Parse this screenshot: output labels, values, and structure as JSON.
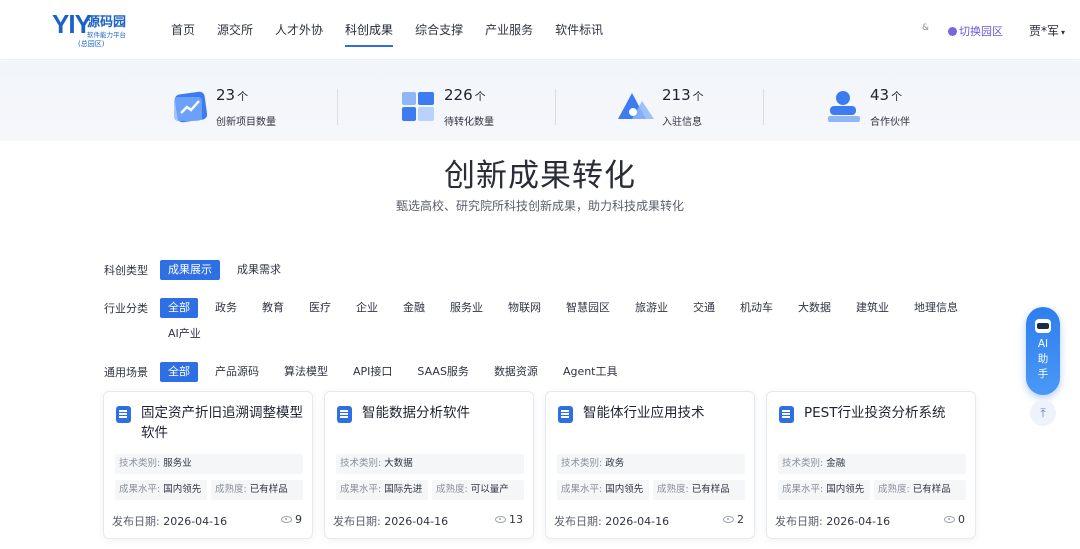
{
  "logo": {
    "mark": "YIY",
    "name": "源码园",
    "subtitle": "软件能力平台",
    "park": "(总园区)"
  },
  "nav": {
    "items": [
      {
        "label": "首页"
      },
      {
        "label": "源交所"
      },
      {
        "label": "人才外协"
      },
      {
        "label": "科创成果",
        "active": true
      },
      {
        "label": "综合支撑"
      },
      {
        "label": "产业服务"
      },
      {
        "label": "软件标讯"
      }
    ]
  },
  "header_right": {
    "lang": "&",
    "switch_label": "切换园区",
    "user_name": "贾*军",
    "caret": "▾"
  },
  "stats": [
    {
      "value": "23",
      "unit": "个",
      "label": "创新项目数量",
      "icon": "chart-growth-icon"
    },
    {
      "value": "226",
      "unit": "个",
      "label": "待转化数量",
      "icon": "blocks-icon"
    },
    {
      "value": "213",
      "unit": "个",
      "label": "入驻信息",
      "icon": "triangle-shapes-icon"
    },
    {
      "value": "43",
      "unit": "个",
      "label": "合作伙伴",
      "icon": "partner-person-icon"
    }
  ],
  "hero": {
    "title": "创新成果转化",
    "subtitle": "甄选高校、研究院所科技创新成果，助力科技成果转化"
  },
  "filters": {
    "type": {
      "label": "科创类型",
      "options": [
        "成果展示",
        "成果需求"
      ],
      "selected": 0
    },
    "industry": {
      "label": "行业分类",
      "options": [
        "全部",
        "政务",
        "教育",
        "医疗",
        "企业",
        "金融",
        "服务业",
        "物联网",
        "智慧园区",
        "旅游业",
        "交通",
        "机动车",
        "大数据",
        "建筑业",
        "地理信息",
        "AI产业"
      ],
      "selected": 0
    },
    "scene": {
      "label": "通用场景",
      "options": [
        "全部",
        "产品源码",
        "算法模型",
        "API接口",
        "SAAS服务",
        "数据资源",
        "Agent工具"
      ],
      "selected": 0
    }
  },
  "cards": [
    {
      "title": "固定资产折旧追溯调整模型软件",
      "tech_key": "技术类别:",
      "tech": "服务业",
      "level_key": "成果水平:",
      "level": "国内领先",
      "maturity_key": "成熟度:",
      "maturity": "已有样品",
      "date_key": "发布日期:",
      "date": "2026-04-16",
      "views": "9"
    },
    {
      "title": "智能数据分析软件",
      "tech_key": "技术类别:",
      "tech": "大数据",
      "level_key": "成果水平:",
      "level": "国际先进",
      "maturity_key": "成熟度:",
      "maturity": "可以量产",
      "date_key": "发布日期:",
      "date": "2026-04-16",
      "views": "13"
    },
    {
      "title": "智能体行业应用技术",
      "tech_key": "技术类别:",
      "tech": "政务",
      "level_key": "成果水平:",
      "level": "国内领先",
      "maturity_key": "成熟度:",
      "maturity": "已有样品",
      "date_key": "发布日期:",
      "date": "2026-04-16",
      "views": "2"
    },
    {
      "title": "PEST行业投资分析系统",
      "tech_key": "技术类别:",
      "tech": "金融",
      "level_key": "成果水平:",
      "level": "国内领先",
      "maturity_key": "成熟度:",
      "maturity": "已有样品",
      "date_key": "发布日期:",
      "date": "2026-04-16",
      "views": "0"
    }
  ],
  "ai_widget": {
    "line1": "AI",
    "line2": "助",
    "line3": "手",
    "top_arrow": "⤒"
  },
  "colors": {
    "accent": "#2f6fe4",
    "brand": "#1a62c8",
    "switch": "#6e56d8"
  }
}
